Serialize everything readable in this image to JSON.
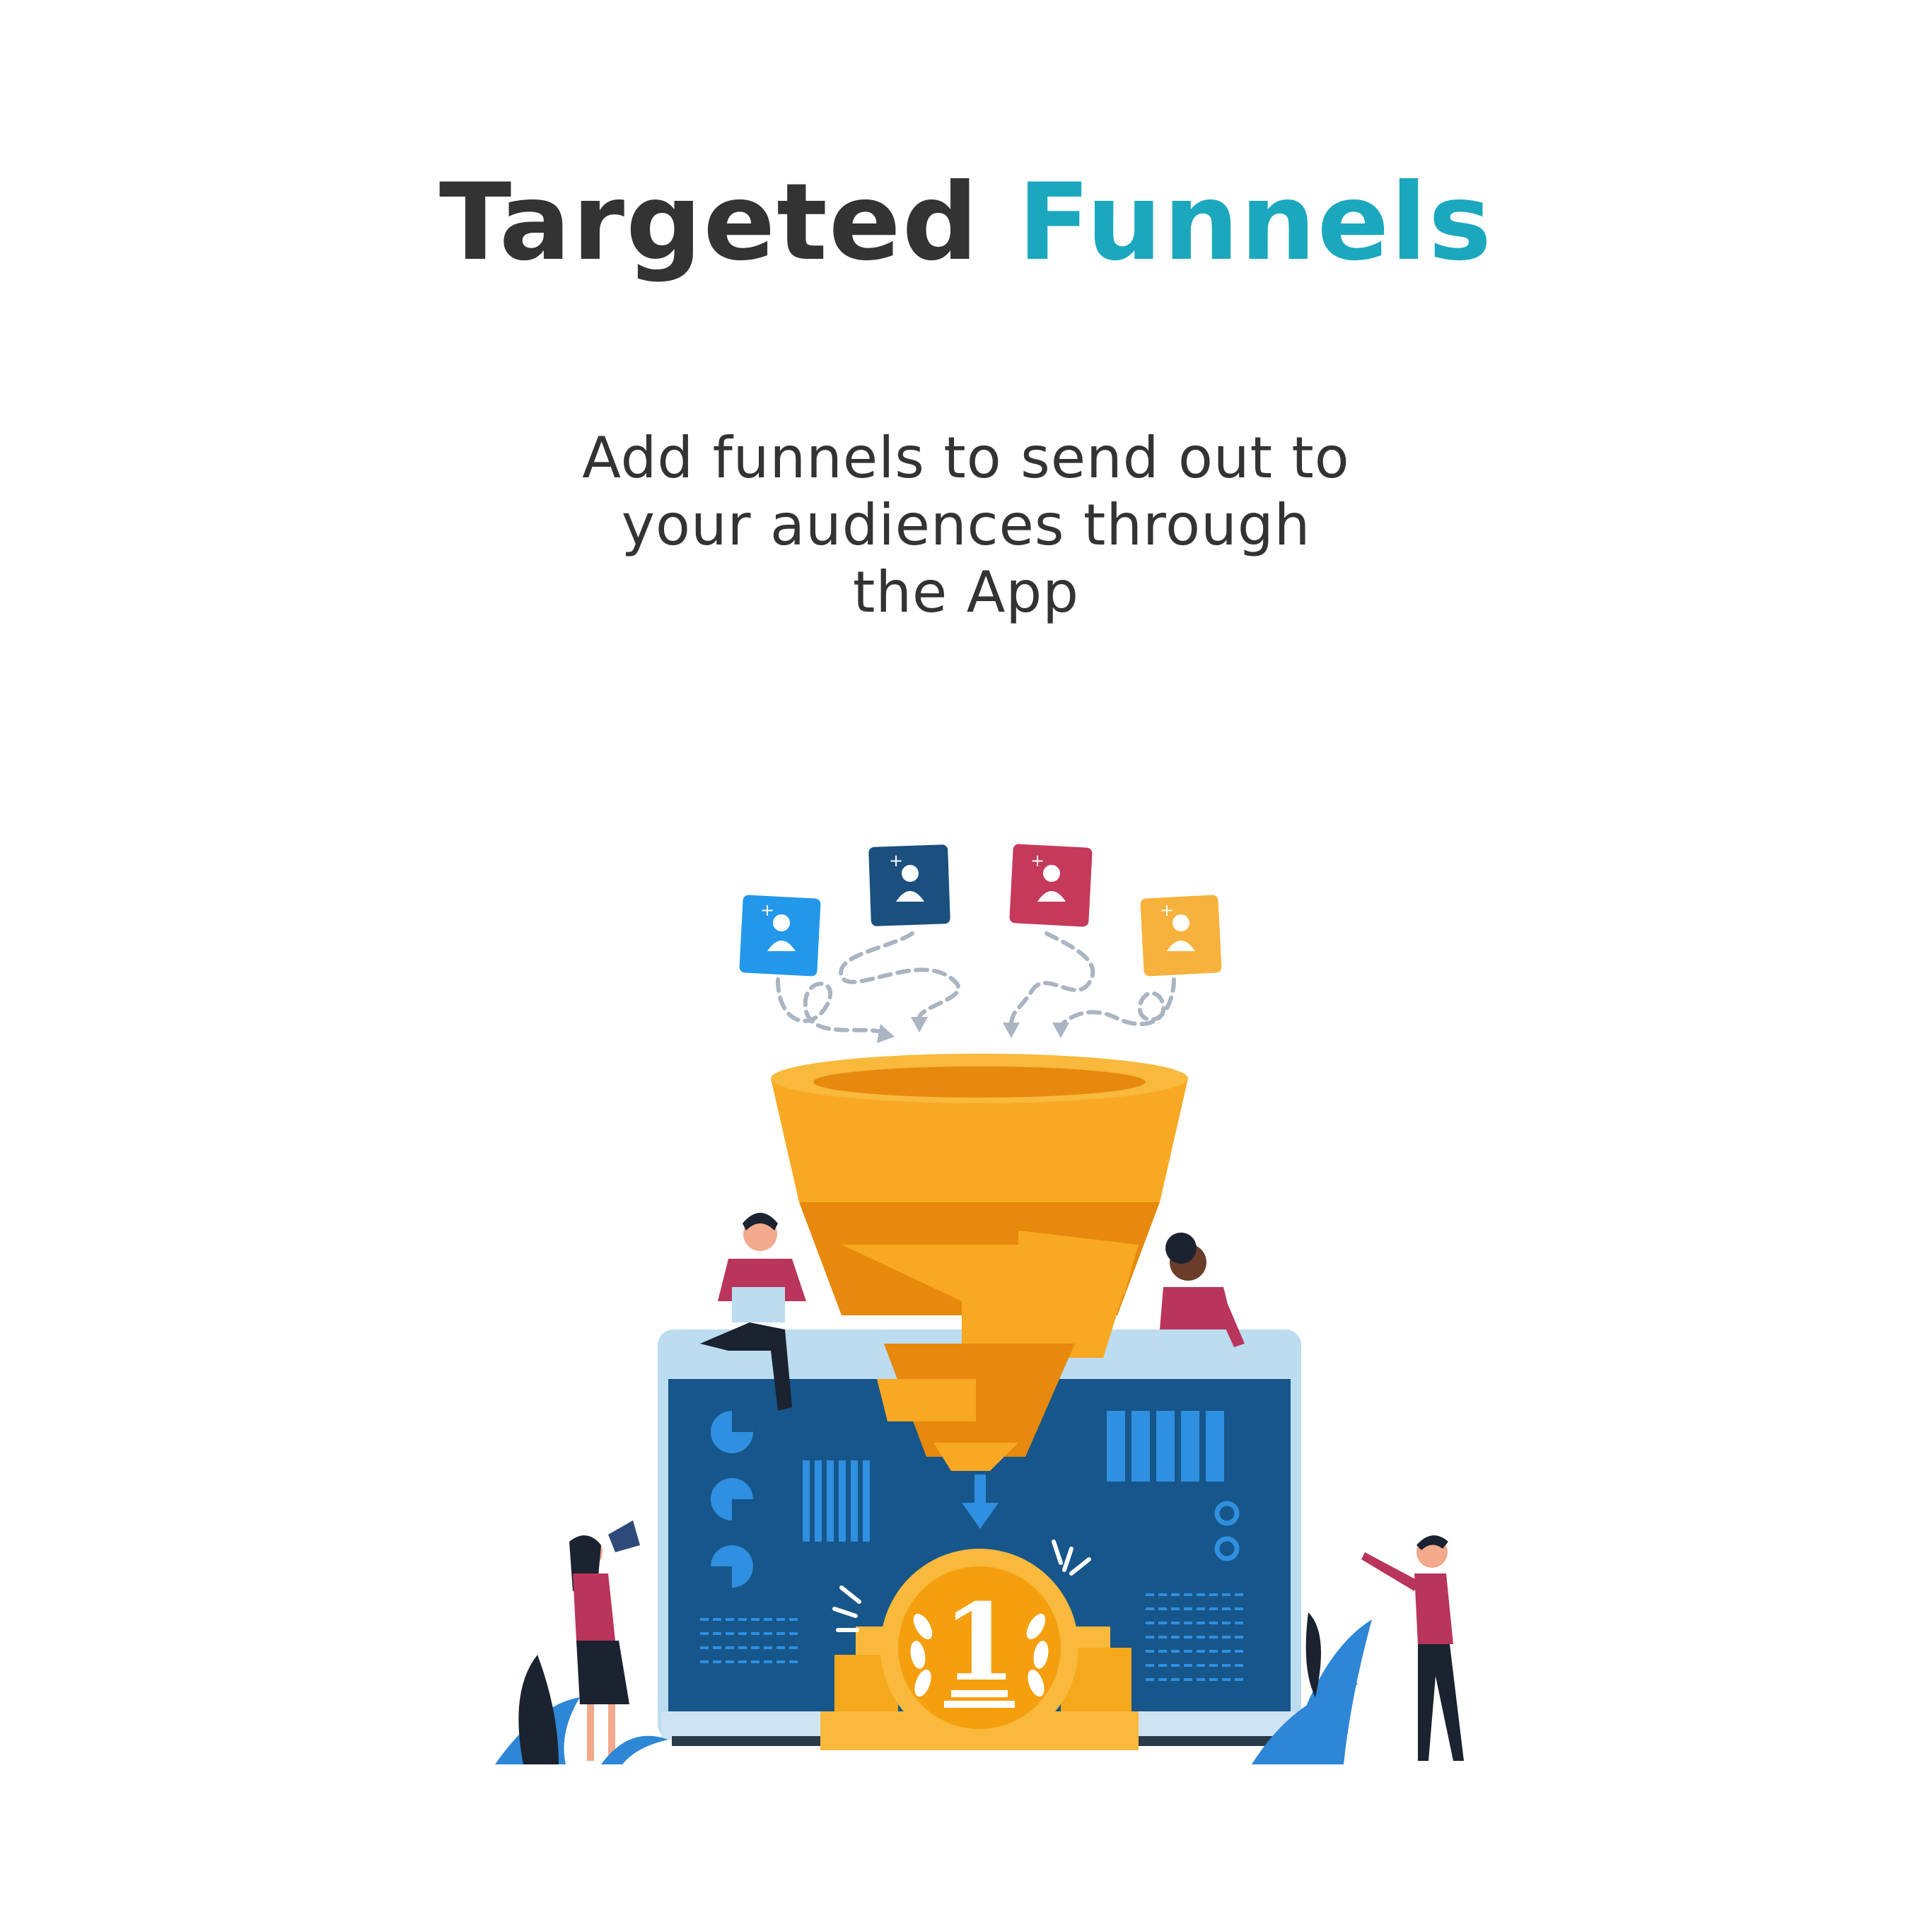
{
  "headline": {
    "part1": "Targeted",
    "part2": "Funnels",
    "color_dark": "#333333",
    "color_accent": "#1ba8be"
  },
  "subtitle": {
    "line1": "Add funnels to send out to",
    "line2": "your audiences through",
    "line3": "the App"
  },
  "illustration": {
    "description_icons": [
      "user-card-icon",
      "user-card-icon",
      "user-card-icon",
      "user-card-icon",
      "funnel-icon",
      "laptop-icon",
      "gold-medal-icon",
      "megaphone-icon",
      "plant-icon"
    ],
    "medal_number": "1",
    "colors": {
      "funnel": "#f8a822",
      "funnel_dark": "#e6890c",
      "screen": "#17568a",
      "screen_frame": "#bcdcf0",
      "card_blue": "#2398ea",
      "card_navy": "#1a4f7e",
      "card_red": "#c5395b",
      "card_yellow": "#f6b23c",
      "shirt": "#b9355b",
      "plant": "#2e86d6"
    }
  }
}
